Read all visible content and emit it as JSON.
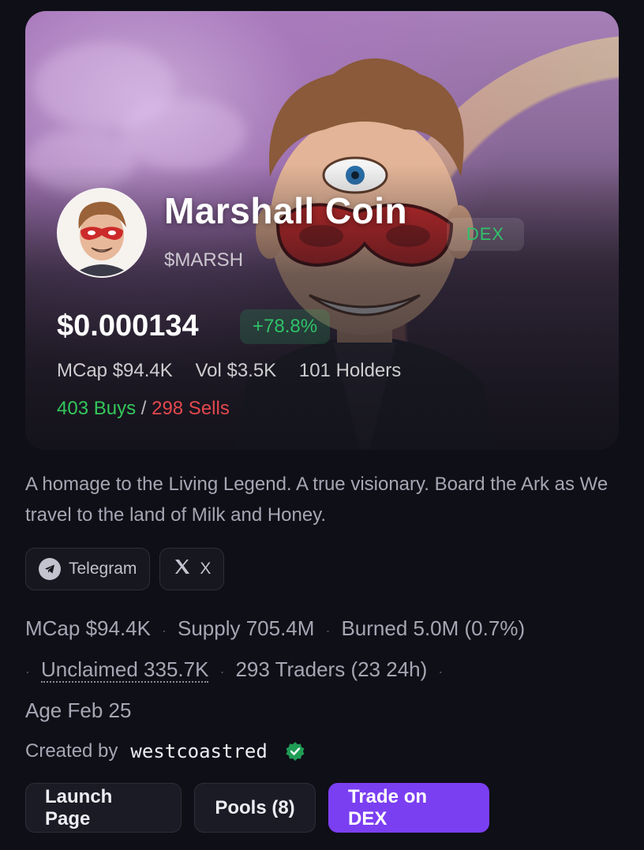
{
  "coin": {
    "name": "Marshall Coin",
    "ticker": "$MARSH",
    "badge": "DEX",
    "price": "$0.000134",
    "change": "+78.8%",
    "stats": {
      "mcap": "MCap $94.4K",
      "vol": "Vol $3.5K",
      "holders": "101 Holders"
    },
    "trades": {
      "buys": "403 Buys",
      "separator": "/",
      "sells": "298 Sells"
    }
  },
  "description": "A homage to the Living Legend. A true visionary. Board the Ark as We travel to the land of Milk and Honey.",
  "socials": {
    "telegram": "Telegram",
    "x": "X"
  },
  "meta": {
    "mcap": "MCap $94.4K",
    "supply": "Supply 705.4M",
    "burned": "Burned 5.0M (0.7%)",
    "unclaimed": "Unclaimed 335.7K",
    "traders": "293 Traders (23 24h)",
    "age": "Age Feb 25"
  },
  "creator": {
    "label": "Created by",
    "name": "westcoastred"
  },
  "actions": {
    "launch": "Launch Page",
    "pools": "Pools (8)",
    "trade": "Trade on DEX"
  },
  "colors": {
    "background": "#0f0f17",
    "positive": "#2fc26a",
    "negative": "#e5484d",
    "accent": "#7b3ff2"
  },
  "icons": [
    "telegram-icon",
    "x-icon",
    "verified-icon",
    "avatar"
  ]
}
